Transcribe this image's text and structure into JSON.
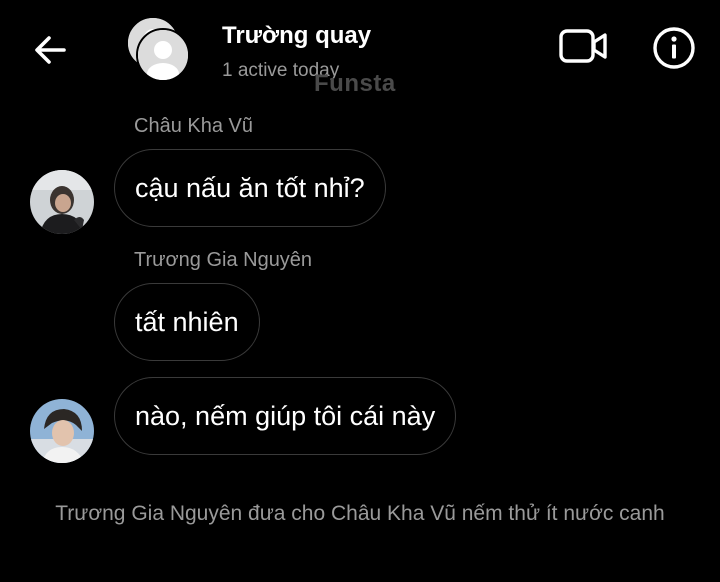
{
  "header": {
    "title": "Trường quay",
    "subtitle": "1 active today",
    "watermark": "Funsta"
  },
  "icons": {
    "back": "arrow-left-icon",
    "video": "video-camera-icon",
    "info": "info-icon"
  },
  "messages": [
    {
      "sender": "Châu Kha Vũ",
      "text": "cậu nấu ăn tốt nhỉ?"
    },
    {
      "sender": "Trương Gia Nguyên",
      "text": "tất nhiên"
    },
    {
      "sender": "",
      "text": "nào, nếm giúp tôi cái này"
    }
  ],
  "system_message": "Trương Gia Nguyên đưa cho Châu Kha Vũ nếm thử ít nước canh",
  "colors": {
    "background": "#000000",
    "text": "#ffffff",
    "muted": "#9a9a9a",
    "bubble_border": "#3a3a3a"
  }
}
